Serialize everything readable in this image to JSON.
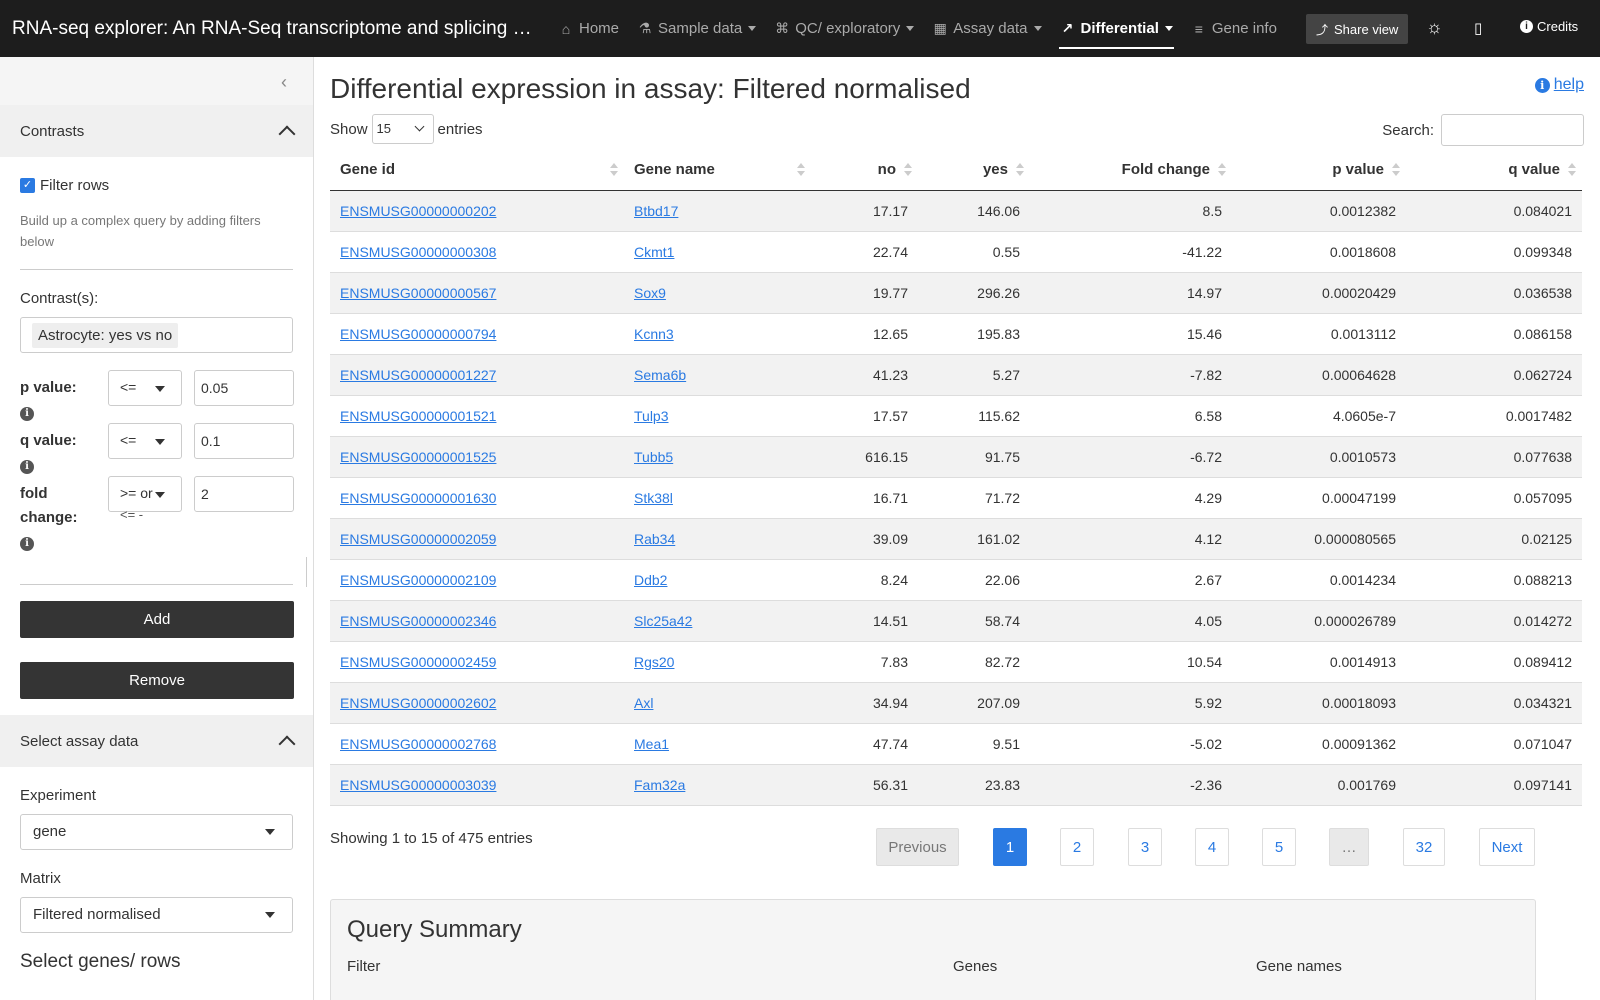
{
  "navbar": {
    "brand": "RNA-seq explorer: An RNA-Seq transcriptome and splicing d...",
    "items": [
      {
        "label": "Home",
        "icon": "⌂",
        "dropdown": false,
        "active": false
      },
      {
        "label": "Sample data",
        "icon": "⚗",
        "dropdown": true,
        "active": false
      },
      {
        "label": "QC/ exploratory",
        "icon": "⌘",
        "dropdown": true,
        "active": false
      },
      {
        "label": "Assay data",
        "icon": "▦",
        "dropdown": true,
        "active": false
      },
      {
        "label": "Differential",
        "icon": "↗",
        "dropdown": true,
        "active": true
      },
      {
        "label": "Gene info",
        "icon": "≡",
        "dropdown": false,
        "active": false
      }
    ],
    "share_label": "Share view",
    "credits_label": "Credits"
  },
  "sidebar": {
    "contrasts_header": "Contrasts",
    "filter_rows_label": "Filter rows",
    "help_text": "Build up a complex query by adding filters below",
    "contrasts_label": "Contrast(s):",
    "contrast_tag": "Astrocyte: yes vs no",
    "filters": [
      {
        "label": "p value:",
        "op": "<=",
        "value": "0.05"
      },
      {
        "label": "q value:",
        "op": "<=",
        "value": "0.1"
      },
      {
        "label": "fold change:",
        "op": ">= or",
        "op_overflow": "<= -",
        "value": "2"
      }
    ],
    "add_label": "Add",
    "remove_label": "Remove",
    "assay_header": "Select assay data",
    "experiment_label": "Experiment",
    "experiment_value": "gene",
    "matrix_label": "Matrix",
    "matrix_value": "Filtered normalised",
    "select_rows_heading": "Select genes/ rows"
  },
  "main": {
    "title": "Differential expression in assay: Filtered normalised",
    "help_label": "help",
    "show_label": "Show",
    "length_value": "15",
    "entries_label": "entries",
    "search_label": "Search:",
    "columns": [
      "Gene id",
      "Gene name",
      "no",
      "yes",
      "Fold change",
      "p value",
      "q value"
    ],
    "rows": [
      [
        "ENSMUSG00000000202",
        "Btbd17",
        "17.17",
        "146.06",
        "8.5",
        "0.0012382",
        "0.084021"
      ],
      [
        "ENSMUSG00000000308",
        "Ckmt1",
        "22.74",
        "0.55",
        "-41.22",
        "0.0018608",
        "0.099348"
      ],
      [
        "ENSMUSG00000000567",
        "Sox9",
        "19.77",
        "296.26",
        "14.97",
        "0.00020429",
        "0.036538"
      ],
      [
        "ENSMUSG00000000794",
        "Kcnn3",
        "12.65",
        "195.83",
        "15.46",
        "0.0013112",
        "0.086158"
      ],
      [
        "ENSMUSG00000001227",
        "Sema6b",
        "41.23",
        "5.27",
        "-7.82",
        "0.00064628",
        "0.062724"
      ],
      [
        "ENSMUSG00000001521",
        "Tulp3",
        "17.57",
        "115.62",
        "6.58",
        "4.0605e-7",
        "0.0017482"
      ],
      [
        "ENSMUSG00000001525",
        "Tubb5",
        "616.15",
        "91.75",
        "-6.72",
        "0.0010573",
        "0.077638"
      ],
      [
        "ENSMUSG00000001630",
        "Stk38l",
        "16.71",
        "71.72",
        "4.29",
        "0.00047199",
        "0.057095"
      ],
      [
        "ENSMUSG00000002059",
        "Rab34",
        "39.09",
        "161.02",
        "4.12",
        "0.000080565",
        "0.02125"
      ],
      [
        "ENSMUSG00000002109",
        "Ddb2",
        "8.24",
        "22.06",
        "2.67",
        "0.0014234",
        "0.088213"
      ],
      [
        "ENSMUSG00000002346",
        "Slc25a42",
        "14.51",
        "58.74",
        "4.05",
        "0.000026789",
        "0.014272"
      ],
      [
        "ENSMUSG00000002459",
        "Rgs20",
        "7.83",
        "82.72",
        "10.54",
        "0.0014913",
        "0.089412"
      ],
      [
        "ENSMUSG00000002602",
        "Axl",
        "34.94",
        "207.09",
        "5.92",
        "0.00018093",
        "0.034321"
      ],
      [
        "ENSMUSG00000002768",
        "Mea1",
        "47.74",
        "9.51",
        "-5.02",
        "0.00091362",
        "0.071047"
      ],
      [
        "ENSMUSG00000003039",
        "Fam32a",
        "56.31",
        "23.83",
        "-2.36",
        "0.001769",
        "0.097141"
      ]
    ],
    "info_text": "Showing 1 to 15 of 475 entries",
    "pagination": [
      "Previous",
      "1",
      "2",
      "3",
      "4",
      "5",
      "…",
      "32",
      "Next"
    ],
    "summary": {
      "title": "Query Summary",
      "columns": [
        "Filter",
        "Genes",
        "Gene names"
      ]
    }
  },
  "colors": {
    "navbar_bg": "#1d1d1d",
    "accent": "#2a7ae2",
    "button_dark": "#343434"
  }
}
